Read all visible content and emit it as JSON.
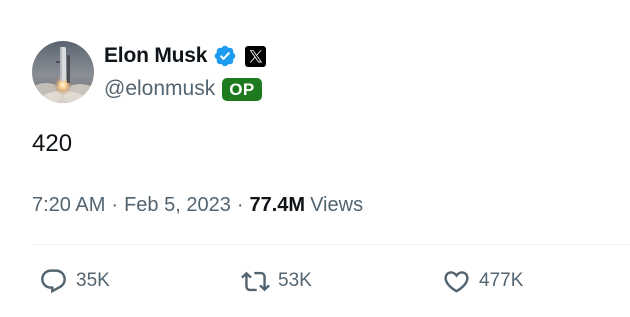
{
  "author": {
    "display_name": "Elon Musk",
    "handle": "@elonmusk",
    "badge": "OP",
    "avatar": "starship-launch-avatar",
    "verified_icon": "verified-badge-icon",
    "affiliation_icon": "x-logo-icon"
  },
  "tweet": {
    "text": "420"
  },
  "meta": {
    "time": "7:20 AM",
    "separator": "·",
    "date": "Feb 5, 2023",
    "views_count": "77.4M",
    "views_label": "Views"
  },
  "actions": {
    "reply": {
      "icon": "reply-icon",
      "count": "35K"
    },
    "retweet": {
      "icon": "retweet-icon",
      "count": "53K"
    },
    "like": {
      "icon": "heart-icon",
      "count": "477K"
    }
  },
  "colors": {
    "text_primary": "#0f1419",
    "text_secondary": "#536471",
    "verified_blue": "#1d9bf0",
    "op_badge_green": "#1e7a1e",
    "divider": "#eff3f4"
  }
}
